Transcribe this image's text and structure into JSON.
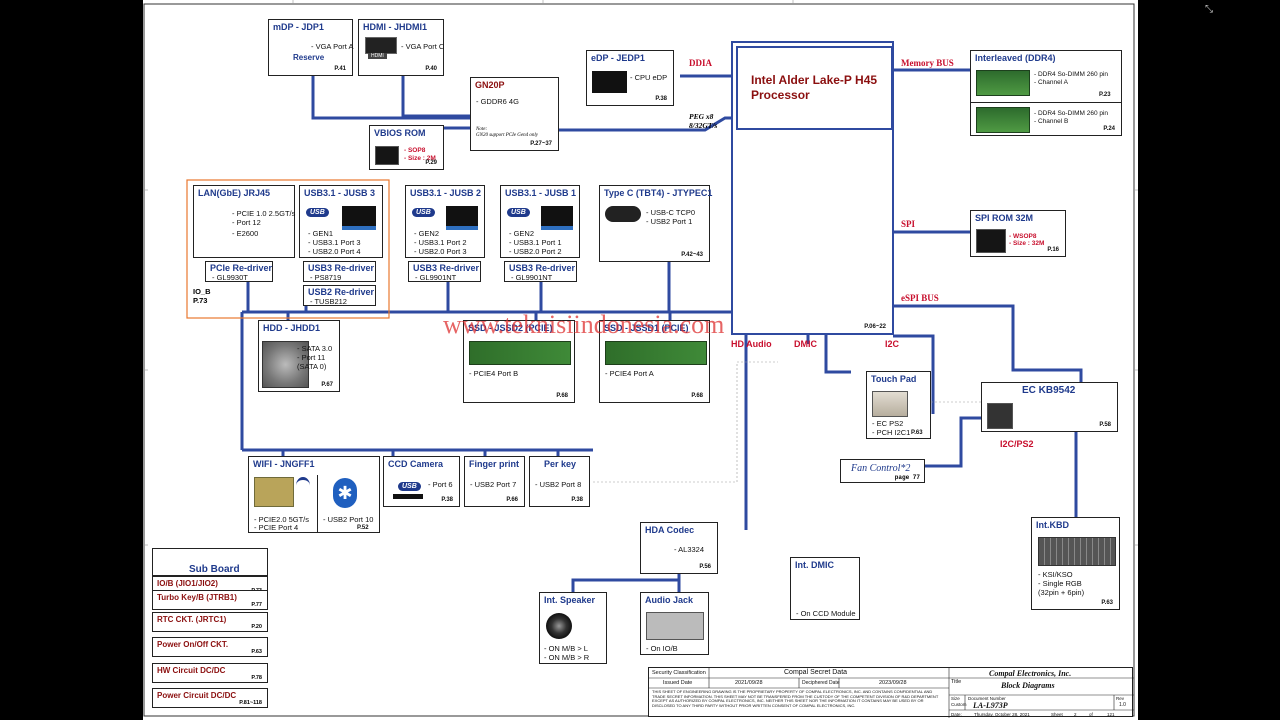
{
  "cpu": {
    "title": "Intel Alder Lake-P H45",
    "subtitle": "Processor",
    "page": "P.06~22"
  },
  "buses": {
    "ddia": "DDIA",
    "memory": "Memory BUS",
    "peg1": "PEG x8",
    "peg2": "8/32GT/s",
    "spi": "SPI",
    "espi": "eSPI BUS",
    "hd_audio": "HD Audio",
    "dmic": "DMIC",
    "i2c": "I2C",
    "i2c_ps2": "I2C/PS2"
  },
  "mdp": {
    "title": "mDP - JDP1",
    "line1": "- VGA Port A",
    "reserve": "Reserve",
    "page": "P.41"
  },
  "hdmi": {
    "title": "HDMI - JHDMI1",
    "line1": "- VGA Port C",
    "logo": "HDMI",
    "page": "P.40"
  },
  "gpu": {
    "title": "GN20P",
    "line1": "- GDDR6 4G",
    "note1": "Note:",
    "note2": "GN20 support PCIe Gen4 only",
    "page": "P.27~37"
  },
  "vbios": {
    "title": "VBIOS ROM",
    "line1": "- SOP8",
    "line2": "- Size : 2M",
    "page": "P.29"
  },
  "edp": {
    "title": "eDP - JEDP1",
    "line1": "- CPU eDP",
    "page": "P.38"
  },
  "ddr": {
    "title": "Interleaved (DDR4)",
    "a1": "- DDR4 So-DIMM 260 pin",
    "a2": "- Channel A",
    "pa": "P.23",
    "b1": "- DDR4 So-DIMM 260 pin",
    "b2": "- Channel B",
    "pb": "P.24"
  },
  "spirom": {
    "title": "SPI ROM 32M",
    "line1": "- WSOP8",
    "line2": "- Size : 32M",
    "page": "P.16"
  },
  "lan": {
    "title": "LAN(GbE) JRJ45",
    "l1": "- PCIE 1.0 2.5GT/s",
    "l2": "- Port 12",
    "l3": "- E2600"
  },
  "usb3": {
    "title": "USB3.1 - JUSB 3",
    "l1": "- GEN1",
    "l2": "- USB3.1 Port 3",
    "l3": "- USB2.0 Port 4"
  },
  "usb2": {
    "title": "USB3.1 - JUSB 2",
    "l1": "- GEN2",
    "l2": "- USB3.1 Port 2",
    "l3": "- USB2.0 Port 3"
  },
  "usb1": {
    "title": "USB3.1 - JUSB 1",
    "l1": "- GEN2",
    "l2": "- USB3.1 Port 1",
    "l3": "- USB2.0 Port 2"
  },
  "typec": {
    "title": "Type C (TBT4) - JTYPEC1",
    "l1": "- USB-C TCP0",
    "l2": "- USB2 Port 1",
    "page": "P.42~43"
  },
  "pcie_redriver": {
    "title": "PCIe Re-driver",
    "line1": "- GL9930T"
  },
  "usb3_redriver_a": {
    "title": "USB3 Re-driver",
    "line1": "- PS8719"
  },
  "usb2_redriver": {
    "title": "USB2 Re-driver",
    "line1": "- TUSB212"
  },
  "usb3_redriver_b": {
    "title": "USB3 Re-driver",
    "line1": "- GL9901NT"
  },
  "usb3_redriver_c": {
    "title": "USB3 Re-driver",
    "line1": "- GL9901NT"
  },
  "iob": {
    "line1": "IO_B",
    "line2": "P.73"
  },
  "usb_logo": "USB",
  "hdd": {
    "title": "HDD - JHDD1",
    "l1": "- SATA 3.0",
    "l2": "- Port 11",
    "l3": "(SATA 0)",
    "page": "P.67"
  },
  "ssd2": {
    "title": "SSD - JSSD2 (PCIE)",
    "l1": "- PCIE4 Port B",
    "page": "P.68"
  },
  "ssd1": {
    "title": "SSD - JSSD1 (PCIE)",
    "l1": "- PCIE4 Port A",
    "page": "P.68"
  },
  "touchpad": {
    "title": "Touch Pad",
    "l1": "- EC PS2",
    "l2": "- PCH I2C1",
    "page": "P.63"
  },
  "ec": {
    "title": "EC KB9542",
    "page": "P.58"
  },
  "fan": {
    "title": "Fan Control*2",
    "page": "page 77"
  },
  "wifi": {
    "title": "WIFI - JNGFF1",
    "l1": "- PCIE2.0  5GT/s",
    "l2": "- PCIE Port 4",
    "l3": "- USB2 Port 10",
    "page": "P.52"
  },
  "ccd": {
    "title": "CCD Camera",
    "l1": "- Port 6",
    "page": "P.38"
  },
  "finger": {
    "title": "Finger print",
    "l1": "- USB2 Port 7",
    "page": "P.66"
  },
  "perkey": {
    "title": "Per key",
    "l1": "- USB2 Port 8",
    "page": "P.38"
  },
  "hda": {
    "title": "HDA Codec",
    "l1": "- AL3324",
    "page": "P.56"
  },
  "dmic_box": {
    "title": "Int. DMIC",
    "l1": "- On CCD Module"
  },
  "kbd": {
    "title": "Int.KBD",
    "l1": "- KSI/KSO",
    "l2": "- Single RGB",
    "l3": "(32pin + 6pin)",
    "page": "P.63"
  },
  "speaker": {
    "title": "Int. Speaker",
    "l1": "- ON M/B > L",
    "l2": "- ON M/B > R"
  },
  "jack": {
    "title": "Audio Jack",
    "l1": "- On IO/B"
  },
  "subboard": {
    "title": "Sub Board",
    "items": [
      {
        "name": "IO/B (JIO1/JIO2)",
        "page": "P.73"
      },
      {
        "name": "Turbo Key/B (JTRB1)",
        "page": "P.77"
      },
      {
        "name": "RTC CKT. (JRTC1)",
        "page": "P.20"
      },
      {
        "name": "Power On/Off CKT.",
        "page": "P.63"
      },
      {
        "name": "HW Circuit DC/DC",
        "page": "P.78"
      },
      {
        "name": "Power Circuit DC/DC",
        "page": "P.81~118"
      }
    ]
  },
  "titleblock": {
    "sec_label": "Security Classification",
    "sec_value": "Compal Secret Data",
    "issued_label": "Issued Date",
    "issued": "2021/09/28",
    "deciphered_label": "Deciphered Date",
    "deciphered": "2023/09/28",
    "company": "Compal Electronics, Inc.",
    "title_label": "Title",
    "title": "Block Diagrams",
    "size_label": "Size",
    "docnum_label": "Document Number",
    "rev_label": "Rev",
    "size": "Custom",
    "docnum": "LA-L973P",
    "rev": "1.0",
    "date_label": "Date:",
    "date": "Thursday, October 28, 2021",
    "sheet_label": "Sheet",
    "sheet": "2",
    "of_label": "of",
    "of": "121",
    "notice": "THIS SHEET OF ENGINEERING DRAWING IS THE PROPRIETARY PROPERTY OF COMPAL ELECTRONICS, INC. AND CONTAINS CONFIDENTIAL AND TRADE SECRET INFORMATION. THIS SHEET MAY NOT BE TRANSFERED FROM THE CUSTODY OF THE COMPETENT DIVISION OF R&D DEPARTMENT EXCEPT AS AUTHORIZED BY COMPAL ELECTRONICS, INC. NEITHER THIS SHEET NOR THE INFORMATION IT CONTAINS MAY BE USED BY OR DISCLOSED TO ANY THIRD PARTY WITHOUT PRIOR WRITTEN CONSENT OF COMPAL ELECTRONICS, INC."
  },
  "watermark": "www.teknisiindonesia.com",
  "colors": {
    "wire": "#2f4aa0",
    "title": "#1f3a8c",
    "bus": "#c8102e",
    "orange": "#e8772e"
  }
}
